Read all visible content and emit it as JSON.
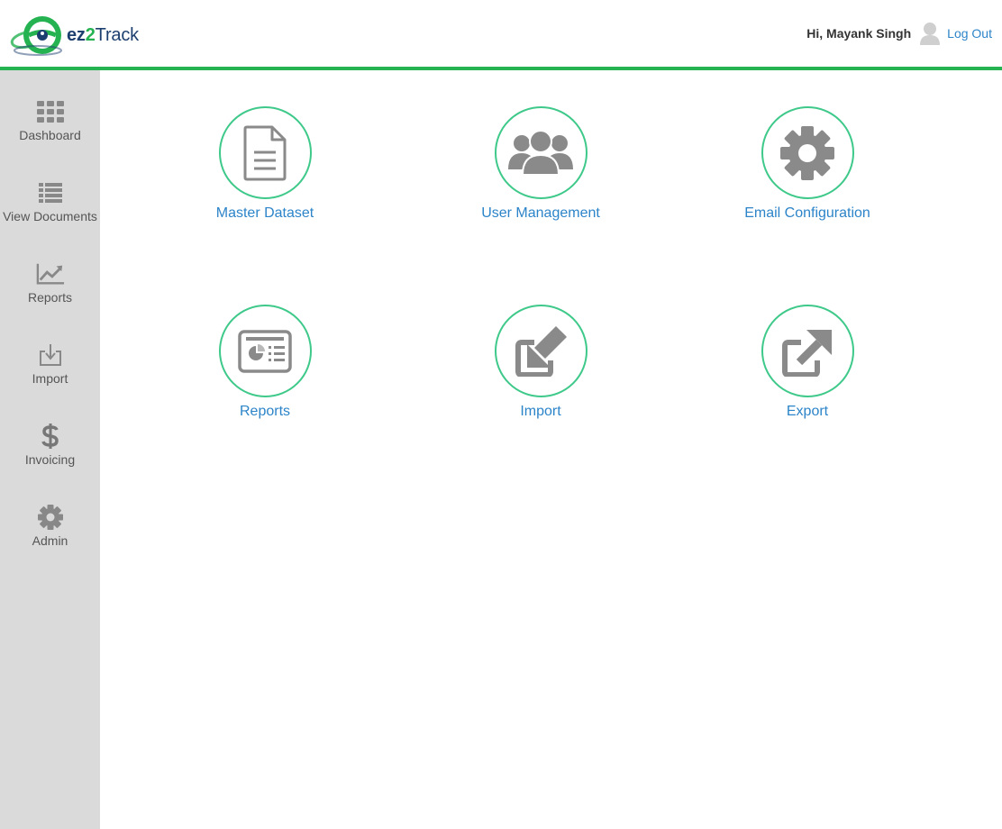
{
  "brand": {
    "name_part1": "ez",
    "name_part2": "2",
    "name_part3": "Track",
    "colors": {
      "navy": "#1d3f6f",
      "green": "#25b352",
      "link": "#2c84c9",
      "ring": "#3ec98a"
    }
  },
  "header": {
    "greeting": "Hi, Mayank Singh",
    "avatar_icon": "user-avatar-icon",
    "logout_label": "Log Out"
  },
  "sidebar": {
    "items": [
      {
        "label": "Dashboard",
        "icon": "grid-icon"
      },
      {
        "label": "View Documents",
        "icon": "list-icon"
      },
      {
        "label": "Reports",
        "icon": "line-chart-icon"
      },
      {
        "label": "Import",
        "icon": "download-tray-icon"
      },
      {
        "label": "Invoicing",
        "icon": "dollar-icon"
      },
      {
        "label": "Admin",
        "icon": "gear-icon"
      }
    ]
  },
  "tiles": [
    {
      "label": "Master Dataset",
      "icon": "document-icon"
    },
    {
      "label": "User Management",
      "icon": "users-icon"
    },
    {
      "label": "Email Configuration",
      "icon": "gear-icon"
    },
    {
      "label": "Reports",
      "icon": "report-card-icon"
    },
    {
      "label": "Import",
      "icon": "import-arrow-icon"
    },
    {
      "label": "Export",
      "icon": "export-arrow-icon"
    }
  ]
}
